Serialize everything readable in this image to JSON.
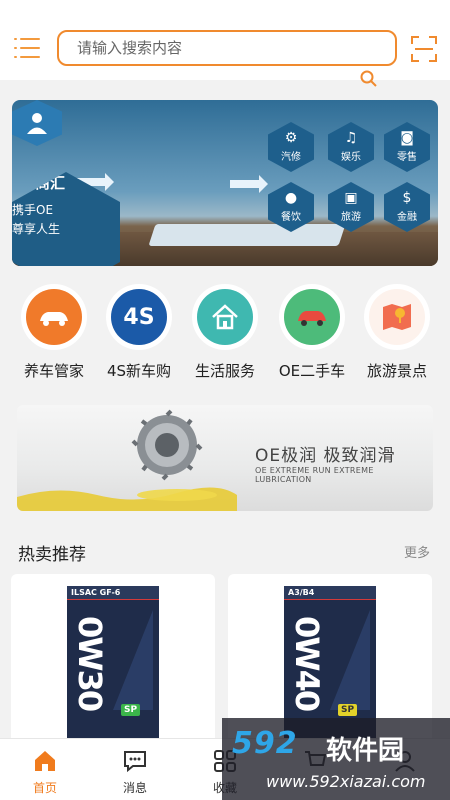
{
  "search": {
    "placeholder": "请输入搜索内容"
  },
  "banner": {
    "hub_title": "OE商汇",
    "hub_line1": "携手OE",
    "hub_line2": "尊享人生",
    "categories": [
      {
        "label": "汽修",
        "icon": "gears-icon"
      },
      {
        "label": "娱乐",
        "icon": "music-icon"
      },
      {
        "label": "零售",
        "icon": "shopping-bag-icon"
      },
      {
        "label": "餐饮",
        "icon": "location-pin-icon"
      },
      {
        "label": "旅游",
        "icon": "car-icon"
      },
      {
        "label": "金融",
        "icon": "money-bag-icon"
      }
    ]
  },
  "quick_links": [
    {
      "label": "养车管家",
      "icon": "car-care-icon",
      "color": "#f07a2a"
    },
    {
      "label": "4S新车购",
      "icon": "4s-badge-icon",
      "color": "#1b5aa8"
    },
    {
      "label": "生活服务",
      "icon": "house-icon",
      "color": "#3fb8b0"
    },
    {
      "label": "OE二手车",
      "icon": "used-car-icon",
      "color": "#4dbb7a"
    },
    {
      "label": "旅游景点",
      "icon": "map-pin-icon",
      "color": "#f16d4f"
    }
  ],
  "ad": {
    "title": "OE极润 极致润滑",
    "subtitle": "OE EXTREME RUN EXTREME LUBRICATION"
  },
  "section": {
    "title": "热卖推荐",
    "more": "更多"
  },
  "products": [
    {
      "cert": "ILSAC GF-6",
      "viscosity": "0W30",
      "grade": "SP",
      "grade_color": "#3bb54a"
    },
    {
      "cert": "A3/B4",
      "viscosity": "0W40",
      "grade": "SP",
      "grade_color": "#e2d22a"
    }
  ],
  "tabs": [
    {
      "label": "首页",
      "icon": "home-icon",
      "active": true
    },
    {
      "label": "消息",
      "icon": "message-icon"
    },
    {
      "label": "收藏",
      "icon": "grid-icon"
    },
    {
      "label": "",
      "icon": "cart-icon"
    },
    {
      "label": "",
      "icon": "profile-icon"
    }
  ],
  "watermark": {
    "brand": "592",
    "brand_cn": "软件园",
    "url": "www.592xiazai.com"
  },
  "colors": {
    "accent": "#f08a2e",
    "banner_blue": "#1f5d86"
  }
}
